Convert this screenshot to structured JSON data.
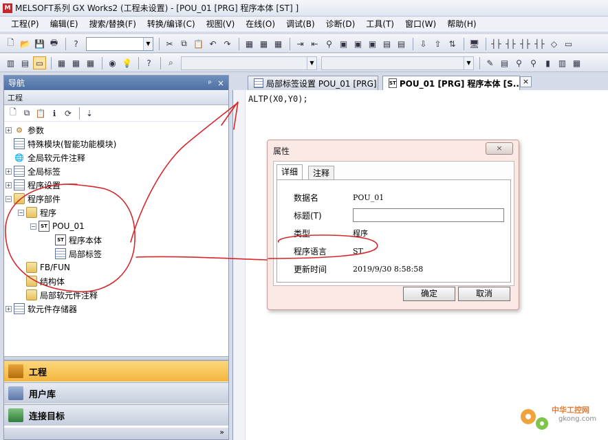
{
  "window": {
    "title": "MELSOFT系列 GX Works2 (工程未设置) - [POU_01 [PRG] 程序本体 [ST] ]"
  },
  "menu": [
    "工程(P)",
    "编辑(E)",
    "搜索/替换(F)",
    "转换/编译(C)",
    "视图(V)",
    "在线(O)",
    "调试(B)",
    "诊断(D)",
    "工具(T)",
    "窗口(W)",
    "帮助(H)"
  ],
  "navigation": {
    "title": "导航",
    "pin_label": "ᵖ",
    "close_label": "×",
    "section": "工程",
    "tree": [
      {
        "label": "参数",
        "exp": "+",
        "icon": "gear"
      },
      {
        "label": "特殊模块(智能功能模块)",
        "exp": "",
        "icon": "module"
      },
      {
        "label": "全局软元件注释",
        "exp": "",
        "icon": "globe"
      },
      {
        "label": "全局标签",
        "exp": "+",
        "icon": "grid"
      },
      {
        "label": "程序设置",
        "exp": "+",
        "icon": "grid"
      },
      {
        "label": "程序部件",
        "exp": "−",
        "icon": "folder"
      },
      {
        "label": "程序",
        "exp": "−",
        "icon": "folder"
      },
      {
        "label": "POU_01",
        "exp": "−",
        "icon": "st"
      },
      {
        "label": "程序本体",
        "exp": "",
        "icon": "st"
      },
      {
        "label": "局部标签",
        "exp": "",
        "icon": "grid"
      },
      {
        "label": "FB/FUN",
        "exp": "",
        "icon": "folder"
      },
      {
        "label": "结构体",
        "exp": "",
        "icon": "folder"
      },
      {
        "label": "局部软元件注释",
        "exp": "",
        "icon": "folder"
      },
      {
        "label": "软元件存储器",
        "exp": "+",
        "icon": "grid"
      }
    ],
    "bottom_tabs": [
      "工程",
      "用户库",
      "连接目标"
    ],
    "more_label": "»"
  },
  "editor": {
    "tabs": [
      {
        "label": "局部标签设置 POU_01 [PRG]",
        "active": false
      },
      {
        "label": "POU_01 [PRG] 程序本体 [S...",
        "active": true
      }
    ],
    "close_label": "×",
    "code": "ALTP(X0,Y0);"
  },
  "dialog": {
    "title": "属性",
    "close_label": "×",
    "tabs": [
      "详细",
      "注释"
    ],
    "fields": [
      {
        "label": "数据名",
        "value": "POU_01"
      },
      {
        "label": "标题(T)",
        "value": ""
      },
      {
        "label": "类型",
        "value": "程序"
      },
      {
        "label": "程序语言",
        "value": "ST"
      },
      {
        "label": "更新时间",
        "value": "2019/9/30 8:58:58"
      }
    ],
    "ok_label": "确定",
    "cancel_label": "取消"
  },
  "watermark": {
    "line1": "中华工控网",
    "line2": "gkong.com"
  },
  "colors": {
    "annotation": "#d6262a",
    "nav_header": "#5a7aae",
    "active_tab": "#f6bb45"
  }
}
